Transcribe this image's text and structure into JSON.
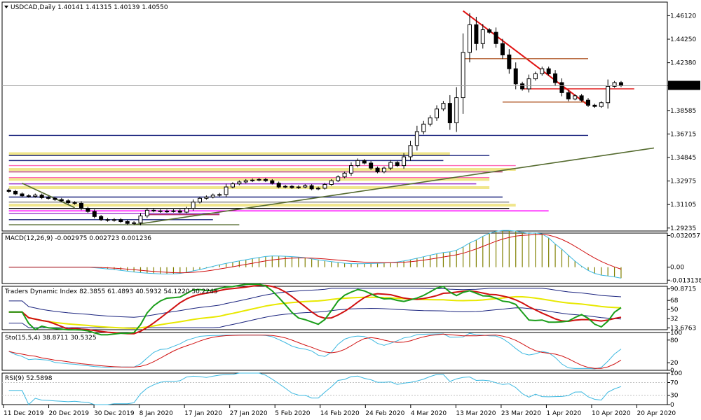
{
  "header": {
    "title": "USDCAD,Daily  1.40141 1.41315 1.40139 1.40550",
    "current_price": "1.40550"
  },
  "chart_data": [
    {
      "type": "candlestick",
      "title": "USDCAD,Daily",
      "symbol": "USDCAD",
      "timeframe": "Daily",
      "ohlc_last": {
        "open": 1.40141,
        "high": 1.41315,
        "low": 1.40139,
        "close": 1.4055
      },
      "ylim": [
        1.29,
        1.472
      ],
      "yticks": [
        1.4612,
        1.4425,
        1.4238,
        1.4055,
        1.38585,
        1.36715,
        1.34845,
        1.32975,
        1.31105,
        1.29235
      ],
      "ytick_labels": [
        "1.46120",
        "1.44250",
        "1.42380",
        "1.40550",
        "1.38585",
        "1.36715",
        "1.34845",
        "1.32975",
        "1.31105",
        "1.29235"
      ],
      "xtick_labels": [
        "11 Dec 2019",
        "20 Dec 2019",
        "30 Dec 2019",
        "8 Jan 2020",
        "17 Jan 2020",
        "27 Jan 2020",
        "5 Feb 2020",
        "14 Feb 2020",
        "24 Feb 2020",
        "4 Mar 2020",
        "13 Mar 2020",
        "23 Mar 2020",
        "1 Apr 2020",
        "10 Apr 2020",
        "20 Apr 2020"
      ],
      "closes": [
        1.3215,
        1.3195,
        1.318,
        1.3175,
        1.3185,
        1.3165,
        1.316,
        1.315,
        1.314,
        1.3125,
        1.312,
        1.308,
        1.3055,
        1.3015,
        1.299,
        1.2985,
        1.299,
        1.2975,
        1.296,
        1.2965,
        1.302,
        1.3065,
        1.306,
        1.3055,
        1.3058,
        1.306,
        1.305,
        1.308,
        1.313,
        1.316,
        1.317,
        1.3185,
        1.319,
        1.325,
        1.3275,
        1.329,
        1.33,
        1.3305,
        1.331,
        1.33,
        1.328,
        1.325,
        1.3255,
        1.3245,
        1.325,
        1.326,
        1.3235,
        1.324,
        1.327,
        1.33,
        1.333,
        1.336,
        1.342,
        1.346,
        1.344,
        1.34,
        1.337,
        1.34,
        1.3445,
        1.342,
        1.349,
        1.358,
        1.369,
        1.375,
        1.38,
        1.387,
        1.3915,
        1.376,
        1.396,
        1.432,
        1.454,
        1.439,
        1.45,
        1.448,
        1.439,
        1.43,
        1.419,
        1.407,
        1.403,
        1.411,
        1.415,
        1.419,
        1.415,
        1.408,
        1.4,
        1.395,
        1.3975,
        1.394,
        1.39,
        1.389,
        1.392,
        1.405,
        1.408,
        1.4055
      ],
      "overlays": [
        {
          "kind": "trendline",
          "name": "Falling trendline",
          "color": "#e01010",
          "from": [
            69,
            1.465
          ],
          "to": [
            88,
            1.39
          ]
        },
        {
          "kind": "hline",
          "color": "#e01010",
          "x_from": 78,
          "x_to": 95,
          "y": 1.403
        },
        {
          "kind": "hline",
          "color": "#b05a2a",
          "x_from": 69,
          "x_to": 88,
          "y": 1.427
        },
        {
          "kind": "hline",
          "color": "#b05a2a",
          "x_from": 75,
          "x_to": 88,
          "y": 1.3925
        },
        {
          "kind": "hline",
          "color": "#1a237e",
          "x_from": 0,
          "x_to": 88,
          "y": 1.366
        },
        {
          "kind": "hline",
          "color": "#1a237e",
          "x_from": 0,
          "x_to": 73,
          "y": 1.35
        },
        {
          "kind": "hline",
          "color": "#1a237e",
          "x_from": 0,
          "x_to": 66,
          "y": 1.346
        },
        {
          "kind": "hline",
          "color": "#f0e68c",
          "x_from": 0,
          "x_to": 67,
          "y": 1.3515,
          "w": 4
        },
        {
          "kind": "hline",
          "color": "#ff69b4",
          "x_from": 0,
          "x_to": 77,
          "y": 1.342
        },
        {
          "kind": "hline",
          "color": "#f0e68c",
          "x_from": 0,
          "x_to": 77,
          "y": 1.339,
          "w": 4
        },
        {
          "kind": "hline",
          "color": "#b03060",
          "x_from": 0,
          "x_to": 75,
          "y": 1.337
        },
        {
          "kind": "hline",
          "color": "#ff69b4",
          "x_from": 0,
          "x_to": 73,
          "y": 1.3325
        },
        {
          "kind": "hline",
          "color": "#f0e68c",
          "x_from": 0,
          "x_to": 73,
          "y": 1.331,
          "w": 4
        },
        {
          "kind": "hline",
          "color": "#9932cc",
          "x_from": 0,
          "x_to": 71,
          "y": 1.3275
        },
        {
          "kind": "hline",
          "color": "#f0e68c",
          "x_from": 0,
          "x_to": 73,
          "y": 1.3245,
          "w": 4
        },
        {
          "kind": "hline",
          "color": "#1a237e",
          "x_from": 0,
          "x_to": 75,
          "y": 1.317
        },
        {
          "kind": "hline",
          "color": "#808080",
          "x_from": 0,
          "x_to": 76,
          "y": 1.313
        },
        {
          "kind": "hline",
          "color": "#f0e68c",
          "x_from": 0,
          "x_to": 77,
          "y": 1.3105,
          "w": 4
        },
        {
          "kind": "hline",
          "color": "#000000",
          "x_from": 0,
          "x_to": 76,
          "y": 1.308
        },
        {
          "kind": "hline",
          "color": "#ff00ff",
          "x_from": 0,
          "x_to": 82,
          "y": 1.306
        },
        {
          "kind": "hline",
          "color": "#9932cc",
          "x_from": 0,
          "x_to": 32,
          "y": 1.304
        },
        {
          "kind": "hline",
          "color": "#b03060",
          "x_from": 21,
          "x_to": 32,
          "y": 1.303
        },
        {
          "kind": "hline",
          "color": "#1a237e",
          "x_from": 0,
          "x_to": 31,
          "y": 1.299
        },
        {
          "kind": "hline",
          "color": "#556b2f",
          "x_from": 0,
          "x_to": 35,
          "y": 1.295
        },
        {
          "kind": "trendline",
          "name": "Rising support",
          "color": "#556b2f",
          "from": [
            19,
            1.295
          ],
          "to": [
            98,
            1.356
          ]
        },
        {
          "kind": "trendline",
          "name": "Falling support",
          "color": "#556b2f",
          "from": [
            2,
            1.328
          ],
          "to": [
            10,
            1.3085
          ]
        }
      ]
    },
    {
      "type": "macd",
      "title": "MACD(12,26,9) -0.002975 0.002723 0.001236",
      "params": [
        12,
        26,
        9
      ],
      "values": [
        -0.002975,
        0.002723,
        0.001236
      ],
      "ylim": [
        -0.0165,
        0.0345
      ],
      "ytick_labels": [
        "0.032057",
        "0.00",
        "-0.013138"
      ],
      "yticks": [
        0.032057,
        0.0,
        -0.013138
      ]
    },
    {
      "type": "line",
      "title": "Traders Dynamic Index 82.3855 61.4893 40.5932 54.1220 50.2245",
      "values": [
        82.3855,
        61.4893,
        40.5932,
        54.122,
        50.2245
      ],
      "ylim": [
        10,
        96
      ],
      "ytick_labels": [
        "90.8715",
        "68",
        "50",
        "32",
        "13.6763"
      ],
      "yticks": [
        90.8715,
        68,
        50,
        32,
        13.6763
      ]
    },
    {
      "type": "line",
      "title": "Sto(15,5,4) 38.8711 30.5325",
      "params": [
        15,
        5,
        4
      ],
      "values": [
        38.8711,
        30.5325
      ],
      "ylim": [
        0,
        100
      ],
      "ytick_labels": [
        "100",
        "80",
        "20",
        "0"
      ],
      "yticks": [
        100,
        80,
        20,
        0
      ]
    },
    {
      "type": "line",
      "title": "RSI(9) 52.5898",
      "params": [
        9
      ],
      "values": [
        52.5898
      ],
      "ylim": [
        0,
        100
      ],
      "ytick_labels": [
        "100",
        "70",
        "30",
        "0"
      ],
      "yticks": [
        100,
        70,
        30,
        0
      ]
    }
  ]
}
